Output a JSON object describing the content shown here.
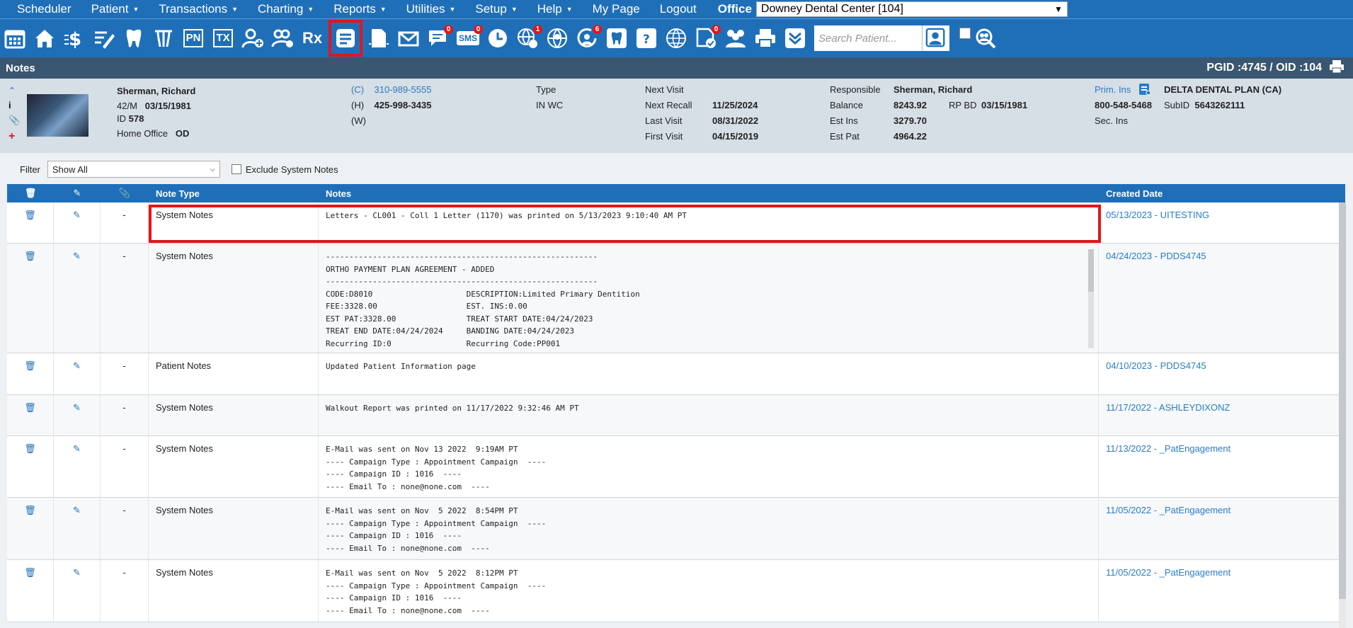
{
  "menu": {
    "items": [
      {
        "label": "Scheduler",
        "caret": false
      },
      {
        "label": "Patient",
        "caret": true
      },
      {
        "label": "Transactions",
        "caret": true
      },
      {
        "label": "Charting",
        "caret": true
      },
      {
        "label": "Reports",
        "caret": true
      },
      {
        "label": "Utilities",
        "caret": true
      },
      {
        "label": "Setup",
        "caret": true
      },
      {
        "label": "Help",
        "caret": true
      },
      {
        "label": "My Page",
        "caret": false
      },
      {
        "label": "Logout",
        "caret": false
      }
    ],
    "office_label": "Office",
    "office_value": "Downey Dental Center [104]"
  },
  "toolbar": {
    "icons": [
      {
        "name": "calendar-icon"
      },
      {
        "name": "home-icon"
      },
      {
        "name": "dollar-icon"
      },
      {
        "name": "edit-list-icon"
      },
      {
        "name": "tooth-icon"
      },
      {
        "name": "tooth-chart-icon"
      },
      {
        "name": "pn-icon",
        "text": "PN"
      },
      {
        "name": "tx-icon",
        "text": "TX"
      },
      {
        "name": "add-patient-icon"
      },
      {
        "name": "add-family-icon"
      },
      {
        "name": "rx-icon",
        "text": "Rx"
      },
      {
        "name": "notes-icon",
        "active": true
      },
      {
        "name": "document-icon"
      },
      {
        "name": "mail-icon"
      },
      {
        "name": "chat-icon",
        "badge": "0"
      },
      {
        "name": "sms-icon",
        "text": "SMS",
        "badge": "0"
      },
      {
        "name": "clock-icon"
      },
      {
        "name": "globe-person-icon",
        "badge": "1"
      },
      {
        "name": "globe-user-icon"
      },
      {
        "name": "refresh-user-icon",
        "badge": "6"
      },
      {
        "name": "tooth-outline-icon"
      },
      {
        "name": "tooth-question-icon"
      },
      {
        "name": "web-icon"
      },
      {
        "name": "doc-check-icon",
        "badge": "0"
      },
      {
        "name": "group-icon"
      },
      {
        "name": "printer-icon"
      },
      {
        "name": "expand-down-icon"
      }
    ],
    "search_placeholder": "Search Patient..."
  },
  "title": {
    "text": "Notes",
    "ids": "PGID :4745  /  OID :104"
  },
  "patient": {
    "name": "Sherman, Richard",
    "agesex": "42/M",
    "dob": "03/15/1981",
    "id_label": "ID",
    "id": "578",
    "home_office_label": "Home Office",
    "home_office": "OD",
    "phone_c_label": "(C)",
    "phone_c": "310-989-5555",
    "phone_h_label": "(H)",
    "phone_h": "425-998-3435",
    "phone_w_label": "(W)",
    "type_label": "Type",
    "type": "IN WC",
    "next_visit_label": "Next Visit",
    "next_recall_label": "Next Recall",
    "next_recall": "11/25/2024",
    "last_visit_label": "Last Visit",
    "last_visit": "08/31/2022",
    "first_visit_label": "First Visit",
    "first_visit": "04/15/2019",
    "responsible_label": "Responsible",
    "responsible": "Sherman, Richard",
    "balance_label": "Balance",
    "balance": "8243.92",
    "rpbd_label": "RP BD",
    "rpbd": "03/15/1981",
    "est_ins_label": "Est Ins",
    "est_ins": "3279.70",
    "est_pat_label": "Est Pat",
    "est_pat": "4964.22",
    "prim_ins_label": "Prim. Ins",
    "prim_ins": "DELTA DENTAL PLAN (CA)",
    "ins_phone": "800-548-5468",
    "subid_label": "SubID",
    "subid": "5643262111",
    "sec_ins_label": "Sec. Ins"
  },
  "filter": {
    "label": "Filter",
    "value": "Show All",
    "exclude_label": "Exclude System Notes"
  },
  "table": {
    "headers": {
      "attach": "",
      "note_type": "Note Type",
      "notes": "Notes",
      "created": "Created Date"
    },
    "rows": [
      {
        "attach": "-",
        "type": "System Notes",
        "notes": "Letters - CL001 - Coll 1 Letter (1170) was printed on 5/13/2023 9:10:40 AM PT",
        "created": "05/13/2023 - UITESTING",
        "height": 58
      },
      {
        "attach": "-",
        "type": "System Notes",
        "notes": "----------------------------------------------------------\nORTHO PAYMENT PLAN AGREEMENT - ADDED\n----------------------------------------------------------\nCODE:D8010                    DESCRIPTION:Limited Primary Dentition\nFEE:3328.00                   EST. INS:0.00\nEST PAT:3328.00               TREAT START DATE:04/24/2023\nTREAT END DATE:04/24/2024     BANDING DATE:04/24/2023\nRecurring ID:0                Recurring Code:PP001",
        "created": "04/24/2023 - PDDS4745",
        "height": 155,
        "scroll": true
      },
      {
        "attach": "-",
        "type": "Patient Notes",
        "notes": "Updated Patient Information page",
        "created": "04/10/2023 - PDDS4745",
        "height": 59
      },
      {
        "attach": "-",
        "type": "System Notes",
        "notes": "Walkout Report was printed on 11/17/2022 9:32:46 AM PT",
        "created": "11/17/2022 - ASHLEYDIXONZ",
        "height": 58
      },
      {
        "attach": "-",
        "type": "System Notes",
        "notes": "E-Mail was sent on Nov 13 2022  9:19AM PT\n---- Campaign Type : Appointment Campaign  ----\n---- Campaign ID : 1016  ----\n---- Email To : none@none.com  ----",
        "created": "11/13/2022 - _PatEngagement",
        "height": 87
      },
      {
        "attach": "-",
        "type": "System Notes",
        "notes": "E-Mail was sent on Nov  5 2022  8:54PM PT\n---- Campaign Type : Appointment Campaign  ----\n---- Campaign ID : 1016  ----\n---- Email To : none@none.com  ----",
        "created": "11/05/2022 - _PatEngagement",
        "height": 88
      },
      {
        "attach": "-",
        "type": "System Notes",
        "notes": "E-Mail was sent on Nov  5 2022  8:12PM PT\n---- Campaign Type : Appointment Campaign  ----\n---- Campaign ID : 1016  ----\n---- Email To : none@none.com  ----",
        "created": "11/05/2022 - _PatEngagement",
        "height": 88
      }
    ]
  }
}
